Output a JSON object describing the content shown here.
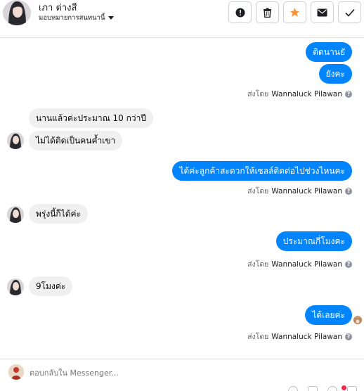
{
  "header": {
    "contact_name": "เภา ต่างสี",
    "assign_label": "มอบหมายการสนทนานี้",
    "actions": [
      "mark-spam-icon",
      "trash-icon",
      "star-icon",
      "mail-icon",
      "check-icon"
    ]
  },
  "messages": [
    {
      "dir": "out",
      "text": "ติดนานยั"
    },
    {
      "dir": "out",
      "text": "ยังคะ",
      "sent_by_prefix": "ส่งโดย",
      "sent_by": "Wannaluck Pilawan"
    },
    {
      "dir": "in",
      "text": "นานแล้วค่ะประมาณ 10 กว่าปี"
    },
    {
      "dir": "in",
      "text": "ไม่ได้ติดเป็นคนค้ำเขา"
    },
    {
      "dir": "out",
      "text": "ได้ค่ะลูกค้าสะดวกให้เซลล์ติดต่อไปช่วงไหนคะ",
      "sent_by_prefix": "ส่งโดย",
      "sent_by": "Wannaluck Pilawan"
    },
    {
      "dir": "in",
      "text": "พรุ่งนี้ก็ได้ค่ะ"
    },
    {
      "dir": "out",
      "text": "ประมาณกี่โมงคะ",
      "sent_by_prefix": "ส่งโดย",
      "sent_by": "Wannaluck Pilawan"
    },
    {
      "dir": "in",
      "text": "9โมงค่ะ"
    },
    {
      "dir": "out",
      "text": "ได้เลยค่ะ",
      "sent_by_prefix": "ส่งโดย",
      "sent_by": "Wannaluck Pilawan"
    }
  ],
  "composer": {
    "placeholder": "ตอบกลับใน Messenger..."
  },
  "colors": {
    "outgoing": "#0084ff",
    "incoming": "#f0f0f0",
    "star": "#f7923b"
  }
}
